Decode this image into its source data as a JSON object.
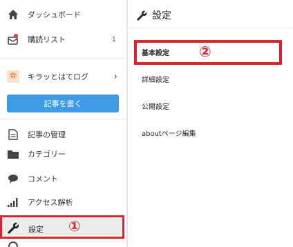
{
  "sidebar": {
    "dashboard": "ダッシュボード",
    "reading_list": "購読リスト",
    "reading_count": "1",
    "blog_name": "キラッとはてログ",
    "write_button": "記事を書く",
    "manage": "記事の管理",
    "category": "カテゴリー",
    "comment": "コメント",
    "analytics": "アクセス解析",
    "settings": "設定"
  },
  "main": {
    "title": "設定",
    "items": [
      "基本設定",
      "詳細設定",
      "公開設定",
      "aboutページ編集"
    ]
  },
  "annotations": {
    "marker1": "①",
    "marker2": "②"
  },
  "colors": {
    "accent_blue": "#3f9be6",
    "annotation_red": "#d7262e"
  }
}
